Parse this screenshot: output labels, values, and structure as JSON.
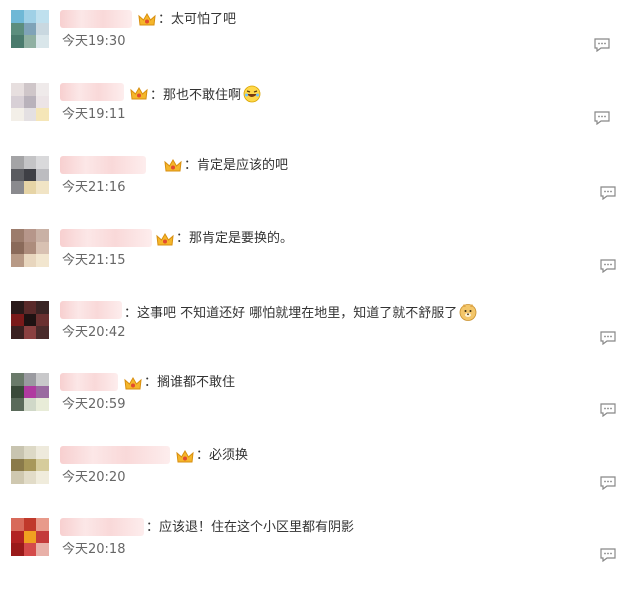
{
  "comments": [
    {
      "text": "：太可怕了吧",
      "time": "今天19:30"
    },
    {
      "text": "：那也不敢住啊",
      "time": "今天19:11"
    },
    {
      "text": "：肯定是应该的吧",
      "time": "今天21:16"
    },
    {
      "text": "：那肯定是要换的。",
      "time": "今天21:15"
    },
    {
      "text": "：这事吧 不知道还好 哪怕就埋在地里，知道了就不舒服了",
      "time": "今天20:42"
    },
    {
      "text": "：搁谁都不敢住",
      "time": "今天20:59"
    },
    {
      "text": "：必须换",
      "time": "今天20:20"
    },
    {
      "text": "：应该退！住在这个小区里都有阴影",
      "time": "今天20:18"
    }
  ],
  "colors": {
    "text": "#333333",
    "time": "#666666",
    "crown": "#f5b62a",
    "icon": "#888888"
  },
  "icons": {
    "crown": "vip-crown-icon",
    "reply": "comment-reply-icon",
    "emoji_laugh": "laughing-emoji-icon",
    "emoji_doge": "doge-emoji-icon"
  }
}
